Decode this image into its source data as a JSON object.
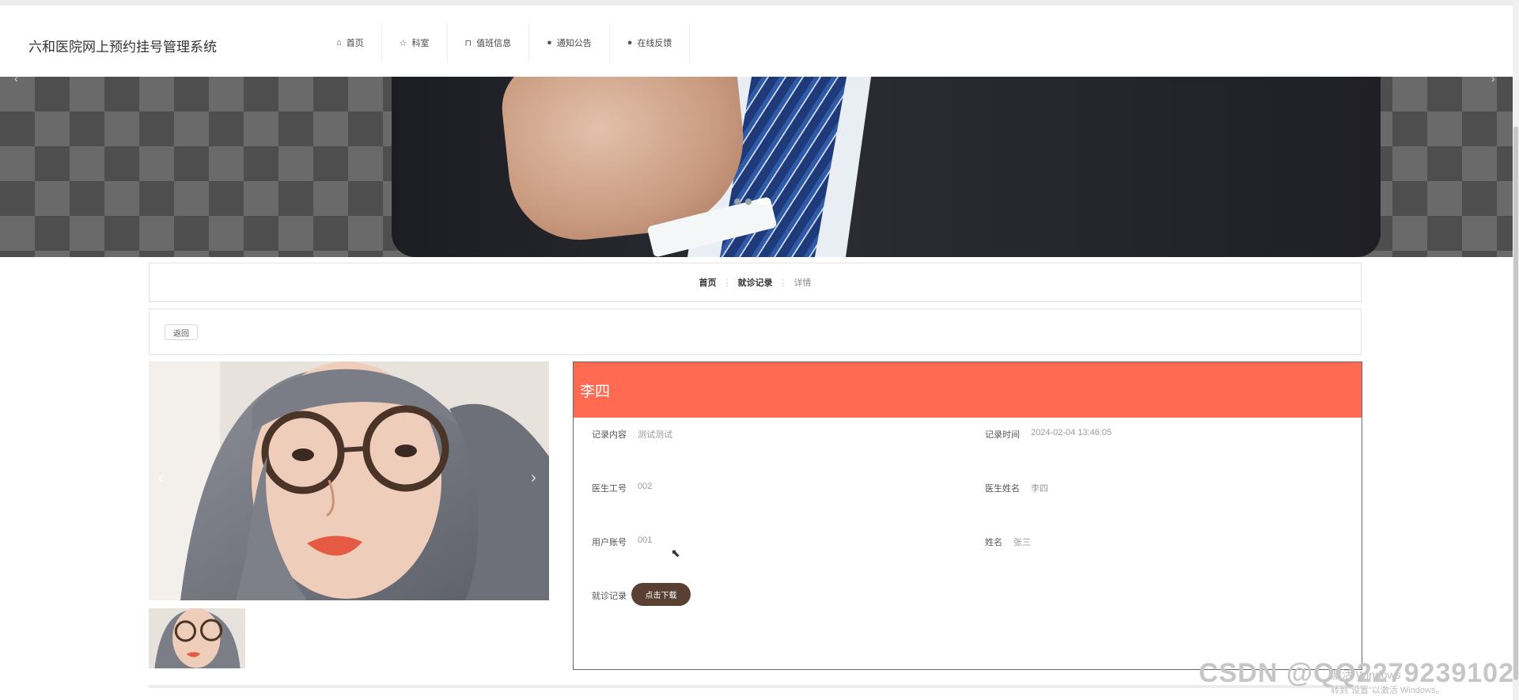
{
  "site": {
    "title": "六和医院网上预约挂号管理系统"
  },
  "nav": {
    "items": [
      {
        "label": "首页",
        "icon": "home-icon",
        "glyph": "⌂"
      },
      {
        "label": "科室",
        "icon": "star-icon",
        "glyph": "☆"
      },
      {
        "label": "值班信息",
        "icon": "bag-icon",
        "glyph": "⊓"
      },
      {
        "label": "通知公告",
        "icon": "info-icon",
        "glyph": "●"
      },
      {
        "label": "在线反馈",
        "icon": "question-icon",
        "glyph": "●"
      }
    ]
  },
  "banner": {
    "active_slide": 3,
    "slides": 3,
    "prev": "‹",
    "next": "›"
  },
  "breadcrumb": {
    "home": "首页",
    "section": "就诊记录",
    "current": "详情",
    "separator": "⋮"
  },
  "back_button": "返回",
  "gallery": {
    "prev": "‹",
    "next": "›"
  },
  "detail": {
    "name": "李四",
    "fields": {
      "record_content": {
        "label": "记录内容",
        "value": "测试测试"
      },
      "record_time": {
        "label": "记录时间",
        "value": "2024-02-04 13:46:05"
      },
      "doctor_id": {
        "label": "医生工号",
        "value": "002"
      },
      "doctor_name": {
        "label": "医生姓名",
        "value": "李四"
      },
      "user_account": {
        "label": "用户账号",
        "value": "001"
      },
      "user_name": {
        "label": "姓名",
        "value": "张三"
      },
      "visit_record": {
        "label": "就诊记录"
      }
    },
    "download_button": "点击下载"
  },
  "overlay": {
    "watermark": "CSDN @QQ2279239102",
    "windows_line1": "激活 Windows",
    "windows_line2": "转到\"设置\"以激活 Windows。"
  },
  "colors": {
    "accent": "#ff6a50",
    "button_dark": "#5a4033"
  }
}
